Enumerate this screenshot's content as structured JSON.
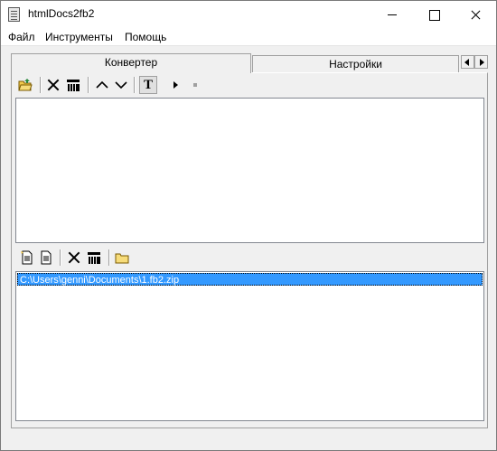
{
  "window": {
    "title": "htmlDocs2fb2"
  },
  "menu": {
    "items": [
      "Файл",
      "Инструменты",
      "Помощь"
    ]
  },
  "tabs": {
    "active": "Конвертер",
    "inactive": "Настройки"
  },
  "toolbar_top": {
    "buttons": [
      "open-folder-icon",
      "delete-icon",
      "clear-icon",
      "move-up-icon",
      "move-down-icon",
      "text-mode-icon",
      "start-icon",
      "stop-icon"
    ],
    "text_mode_glyph": "T"
  },
  "toolbar_bottom": {
    "buttons": [
      "new-document-icon",
      "document-icon",
      "delete-icon",
      "clear-icon",
      "open-folder-icon"
    ]
  },
  "output_list": {
    "items": [
      "C:\\Users\\genni\\Documents\\1.fb2.zip"
    ],
    "selected_index": 0
  },
  "colors": {
    "selection": "#3399ff",
    "folder": "#f2c94c"
  }
}
